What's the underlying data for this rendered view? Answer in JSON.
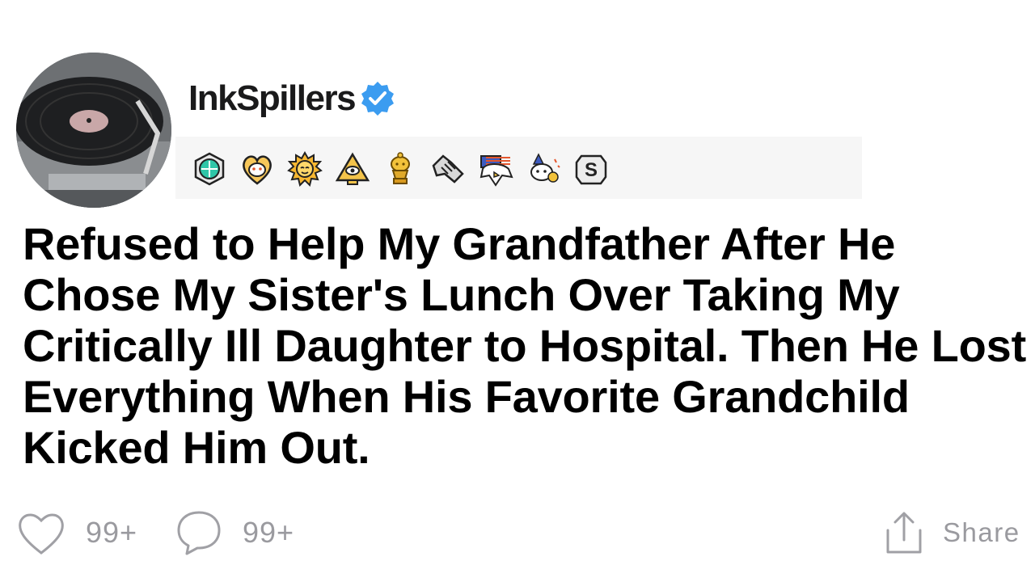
{
  "post": {
    "username": "InkSpillers",
    "verified": true,
    "accent_color": "#3b9cf0",
    "avatar": {
      "icon": "turntable-record-icon"
    },
    "awards": [
      {
        "icon": "hex-gem-award-icon"
      },
      {
        "icon": "heart-snoo-award-icon"
      },
      {
        "icon": "sun-face-award-icon"
      },
      {
        "icon": "pyramid-eye-award-icon"
      },
      {
        "icon": "gold-snoo-trophy-award-icon"
      },
      {
        "icon": "handshake-award-icon"
      },
      {
        "icon": "eagle-flag-award-icon"
      },
      {
        "icon": "snoo-party-hat-award-icon"
      },
      {
        "icon": "silver-s-award-icon"
      }
    ],
    "title": "Refused to Help My Grandfather After He Chose My Sister's Lunch Over Taking My Critically Ill Daughter to Hospital. Then He Lost Everything When His Favorite Grandchild Kicked Him Out.",
    "actions": {
      "likes": "99+",
      "comments": "99+",
      "share_label": "Share"
    }
  }
}
